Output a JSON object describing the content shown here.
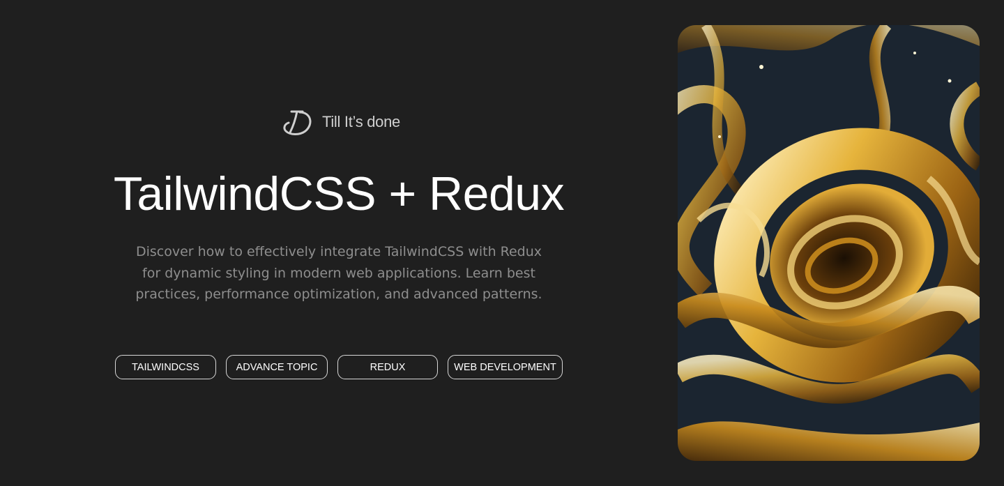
{
  "brand": {
    "logo_icon": "td-monogram-icon",
    "name": "Till It’s done"
  },
  "hero": {
    "title": "TailwindCSS + Redux",
    "description": "Discover how to effectively integrate TailwindCSS with Redux for dynamic styling in modern web applications. Learn best practices, performance optimization, and advanced patterns."
  },
  "tags": [
    {
      "label": "TAILWINDCSS"
    },
    {
      "label": "ADVANCE TOPIC"
    },
    {
      "label": "REDUX"
    },
    {
      "label": "WEB DEVELOPMENT"
    }
  ],
  "artwork": {
    "icon": "golden-swirl-artwork",
    "colors": {
      "gold": "#d9a22a",
      "cream": "#f3e2b6",
      "dark": "#1b2530"
    }
  },
  "colors": {
    "background": "#1f1f1f",
    "title": "#ffffff",
    "description": "#8e8e8e",
    "tag_border": "#d8d8d8"
  }
}
